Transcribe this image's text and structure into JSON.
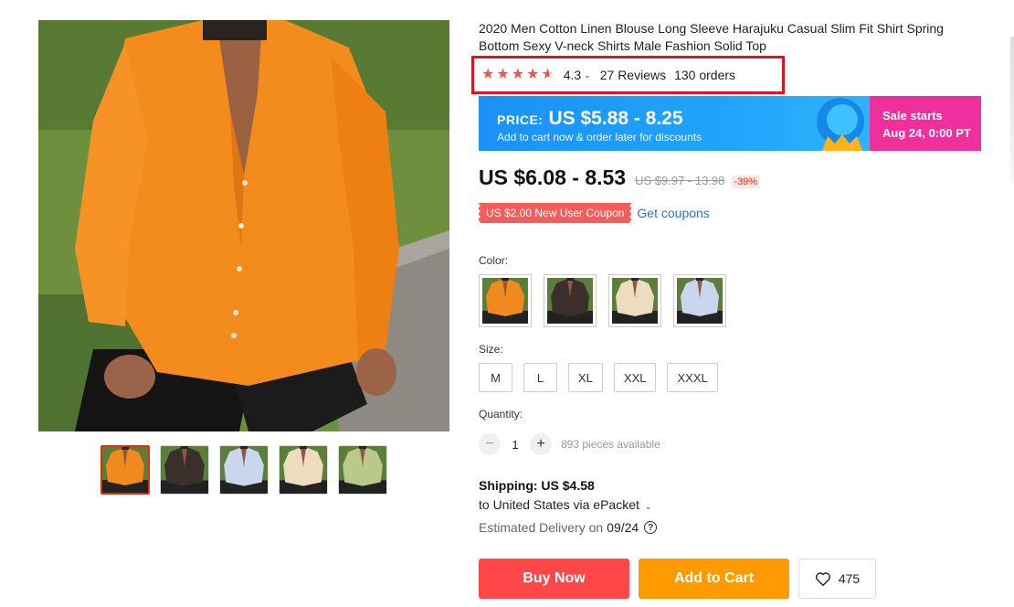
{
  "product": {
    "title": "2020 Men Cotton Linen Blouse Long Sleeve Harajuku Casual Slim Fit Shirt Spring Bottom Sexy V-neck Shirts Male Fashion Solid Top"
  },
  "rating": {
    "value": "4.3",
    "stars": 4.5,
    "reviews": "27 Reviews",
    "orders": "130 orders",
    "highlight_color": "#e3141f"
  },
  "promo": {
    "label": "PRICE:",
    "price": "US $5.88 - 8.25",
    "subtitle": "Add to cart now & order later for discounts",
    "sale_line1": "Sale starts",
    "sale_line2": "Aug 24, 0:00 PT"
  },
  "price": {
    "current": "US $6.08 - 8.53",
    "original": "US $9.97 - 13.98",
    "discount": "-39%"
  },
  "coupon": {
    "tag": "US $2.00 New User Coupon",
    "link": "Get coupons"
  },
  "color": {
    "label": "Color:",
    "options": [
      {
        "name": "orange",
        "shirt": "#f08a1e"
      },
      {
        "name": "black",
        "shirt": "#3a2f2a"
      },
      {
        "name": "beige",
        "shirt": "#eddcc0"
      },
      {
        "name": "light-blue",
        "shirt": "#c9d6ee"
      }
    ]
  },
  "size": {
    "label": "Size:",
    "options": [
      "M",
      "L",
      "XL",
      "XXL",
      "XXXL"
    ]
  },
  "quantity": {
    "label": "Quantity:",
    "minus": "−",
    "plus": "+",
    "value": "1",
    "available": "893 pieces available"
  },
  "shipping": {
    "cost": "Shipping: US $4.58",
    "destination": "to United States via ePacket",
    "delivery_label": "Estimated Delivery on",
    "delivery_date": "09/24"
  },
  "actions": {
    "buy_now": "Buy Now",
    "add_to_cart": "Add to Cart",
    "wishlist_count": "475"
  },
  "gallery": {
    "thumbnails": [
      {
        "name": "orange",
        "shirt": "#f08a1e"
      },
      {
        "name": "black",
        "shirt": "#3a2f2a"
      },
      {
        "name": "light-blue",
        "shirt": "#c9d6ee"
      },
      {
        "name": "beige",
        "shirt": "#eddcc0"
      },
      {
        "name": "green",
        "shirt": "#b8c98a"
      }
    ]
  },
  "colors": {
    "buy_now": "#ff4747",
    "add_to_cart": "#ff9a00",
    "link": "#2476c7",
    "accent_red": "#e62e04"
  }
}
